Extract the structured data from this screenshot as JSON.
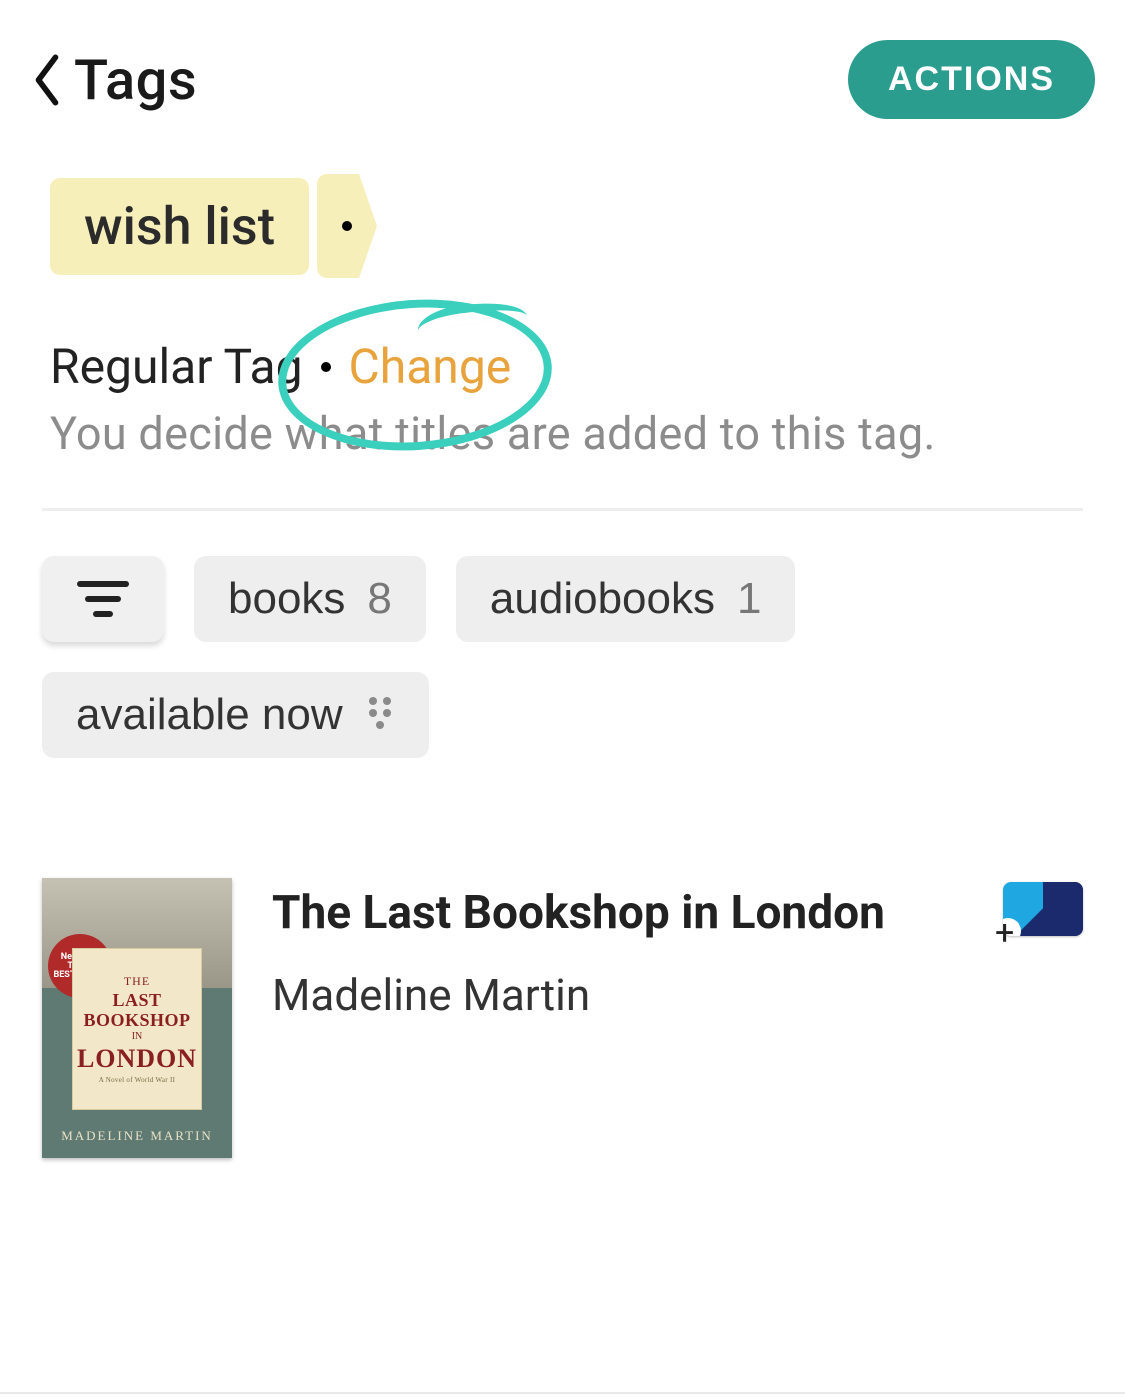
{
  "header": {
    "back_label": "Tags",
    "actions_label": "ACTIONS"
  },
  "tag": {
    "name": "wish list",
    "type_label": "Regular Tag",
    "change_label": "Change",
    "description": "You decide what titles are added to this tag."
  },
  "filters": {
    "books_label": "books",
    "books_count": "8",
    "audiobooks_label": "audiobooks",
    "audiobooks_count": "1",
    "available_label": "available now"
  },
  "books": [
    {
      "title": "The Last Bookshop in London",
      "author": "Madeline Martin",
      "cover": {
        "badge": "New York Times BESTSELLER",
        "t_the": "THE",
        "t_last": "LAST",
        "t_bookshop": "BOOKSHOP",
        "t_in": "IN",
        "t_city": "LONDON",
        "t_sub": "A Novel of World War II",
        "author_band": "MADELINE MARTIN"
      }
    }
  ],
  "colors": {
    "accent_teal": "#2a9d8f",
    "tag_bg": "#f7efba",
    "change_link": "#e8a33d",
    "annotation": "#3ad0bd"
  }
}
